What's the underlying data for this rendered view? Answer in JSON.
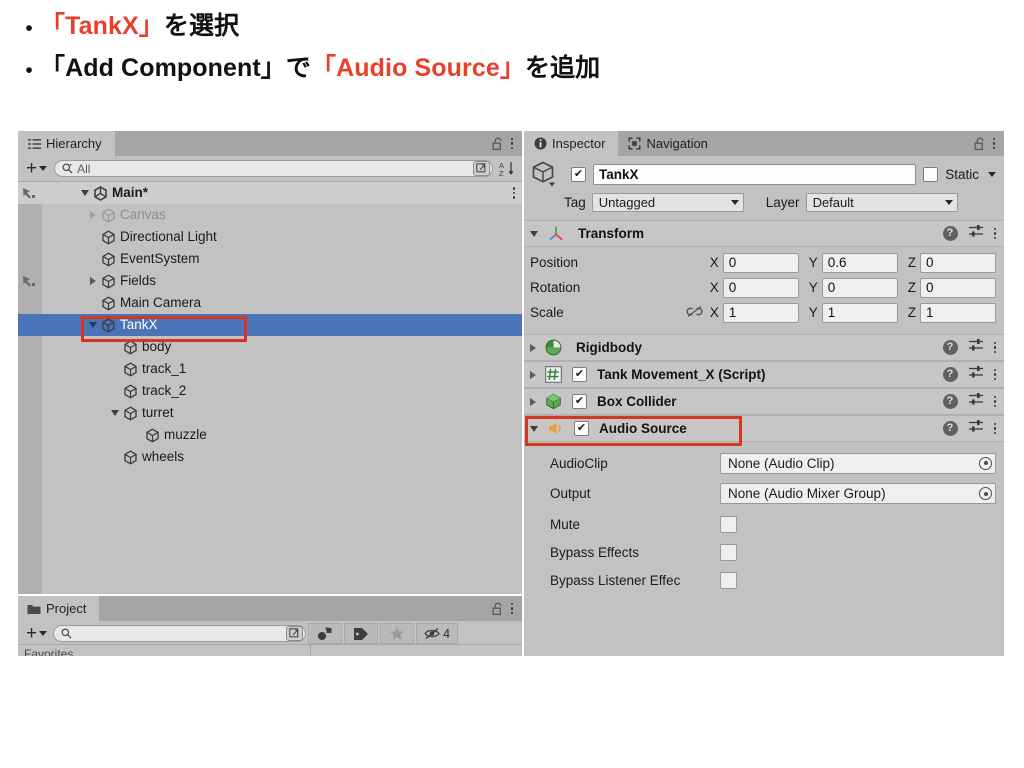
{
  "slide": {
    "bullets": [
      {
        "marker": "•",
        "segments": [
          {
            "text": "「TankX」",
            "color": "red"
          },
          {
            "text": "を選択",
            "color": "black"
          }
        ]
      },
      {
        "marker": "•",
        "segments": [
          {
            "text": "「Add Component」",
            "color": "black"
          },
          {
            "text": "で",
            "color": "black"
          },
          {
            "text": "「Audio Source」",
            "color": "red"
          },
          {
            "text": "を追加",
            "color": "black"
          }
        ]
      }
    ],
    "accent_color": "#e8402a",
    "text_color": "#111111"
  },
  "hierarchy": {
    "tab_label": "Hierarchy",
    "tab_icon": "hierarchy-list-icon",
    "lock_icon": "lock-open-icon",
    "menu_icon": "kebab-menu-icon",
    "toolbar": {
      "create_label": "+",
      "create_dropdown_icon": "chevron-down-icon",
      "search_placeholder": "All",
      "search_value": "",
      "search_icon": "search-icon",
      "search_save_icon": "save-search-icon",
      "sort_icon": "alphabetical-sort-icon",
      "sort_label": "A\nZ"
    },
    "scene": {
      "label": "Main*",
      "icon": "unity-scene-icon",
      "expanded": true,
      "kebab": "kebab-menu-icon"
    },
    "items": [
      {
        "label": "Canvas",
        "depth": 1,
        "expandable": true,
        "expanded": false,
        "dimmed": true,
        "selected": false,
        "gutter_icon": ""
      },
      {
        "label": "Directional Light",
        "depth": 1,
        "expandable": false,
        "expanded": false,
        "dimmed": false,
        "selected": false,
        "gutter_icon": ""
      },
      {
        "label": "EventSystem",
        "depth": 1,
        "expandable": false,
        "expanded": false,
        "dimmed": false,
        "selected": false,
        "gutter_icon": ""
      },
      {
        "label": "Fields",
        "depth": 1,
        "expandable": true,
        "expanded": false,
        "dimmed": false,
        "selected": false,
        "gutter_icon": "prefab-icon"
      },
      {
        "label": "Main Camera",
        "depth": 1,
        "expandable": false,
        "expanded": false,
        "dimmed": false,
        "selected": false,
        "gutter_icon": ""
      },
      {
        "label": "TankX",
        "depth": 1,
        "expandable": true,
        "expanded": true,
        "dimmed": false,
        "selected": true,
        "gutter_icon": ""
      },
      {
        "label": "body",
        "depth": 2,
        "expandable": false,
        "expanded": false,
        "dimmed": false,
        "selected": false,
        "gutter_icon": ""
      },
      {
        "label": "track_1",
        "depth": 2,
        "expandable": false,
        "expanded": false,
        "dimmed": false,
        "selected": false,
        "gutter_icon": ""
      },
      {
        "label": "track_2",
        "depth": 2,
        "expandable": false,
        "expanded": false,
        "dimmed": false,
        "selected": false,
        "gutter_icon": ""
      },
      {
        "label": "turret",
        "depth": 2,
        "expandable": true,
        "expanded": true,
        "dimmed": false,
        "selected": false,
        "gutter_icon": ""
      },
      {
        "label": "muzzle",
        "depth": 3,
        "expandable": false,
        "expanded": false,
        "dimmed": false,
        "selected": false,
        "gutter_icon": ""
      },
      {
        "label": "wheels",
        "depth": 2,
        "expandable": false,
        "expanded": false,
        "dimmed": false,
        "selected": false,
        "gutter_icon": ""
      }
    ],
    "selection_color": "#4a74b8",
    "highlight_box_color": "#d6361f"
  },
  "project": {
    "tab_label": "Project",
    "tab_icon": "folder-icon",
    "lock_icon": "lock-open-icon",
    "menu_icon": "kebab-menu-icon",
    "toolbar": {
      "create_label": "+",
      "create_dropdown_icon": "chevron-down-icon",
      "search_placeholder": "",
      "search_value": "",
      "search_icon": "search-icon",
      "search_save_icon": "save-search-icon",
      "filter_type_icon": "filter-by-type-icon",
      "filter_label_icon": "filter-by-label-icon",
      "favorites_icon": "star-icon",
      "hidden_icon": "eye-hidden-icon",
      "hidden_count": "4"
    },
    "sidebar_hint": "Favorites"
  },
  "inspector": {
    "tabs": [
      {
        "label": "Inspector",
        "icon": "info-icon",
        "active": true
      },
      {
        "label": "Navigation",
        "icon": "navigation-icon",
        "active": false
      }
    ],
    "lock_icon": "lock-open-icon",
    "menu_icon": "kebab-menu-icon",
    "object": {
      "icon": "gameobject-cube-icon",
      "enabled": true,
      "name": "TankX",
      "static_label": "Static",
      "static_checked": false,
      "static_dropdown_icon": "chevron-down-icon",
      "tag_label": "Tag",
      "tag_value": "Untagged",
      "layer_label": "Layer",
      "layer_value": "Default"
    },
    "components": [
      {
        "name": "Transform",
        "icon": "transform-axis-icon",
        "expanded": true,
        "has_toggle": false,
        "enabled": true,
        "highlighted": false,
        "help_icon": "help-icon",
        "preset_icon": "preset-sliders-icon",
        "menu_icon": "kebab-menu-icon",
        "rows": [
          {
            "label": "Position",
            "link_icon": "",
            "x": "0",
            "y": "0.6",
            "z": "0"
          },
          {
            "label": "Rotation",
            "link_icon": "",
            "x": "0",
            "y": "0",
            "z": "0"
          },
          {
            "label": "Scale",
            "link_icon": "broken-link-icon",
            "x": "1",
            "y": "1",
            "z": "1"
          }
        ],
        "axis_labels": {
          "x": "X",
          "y": "Y",
          "z": "Z"
        }
      },
      {
        "name": "Rigidbody",
        "icon": "rigidbody-icon",
        "expanded": false,
        "has_toggle": false,
        "enabled": true,
        "highlighted": false,
        "help_icon": "help-icon",
        "preset_icon": "preset-sliders-icon",
        "menu_icon": "kebab-menu-icon"
      },
      {
        "name": "Tank Movement_X (Script)",
        "icon": "script-hash-icon",
        "expanded": false,
        "has_toggle": true,
        "enabled": true,
        "highlighted": false,
        "help_icon": "help-icon",
        "preset_icon": "preset-sliders-icon",
        "menu_icon": "kebab-menu-icon"
      },
      {
        "name": "Box Collider",
        "icon": "box-collider-icon",
        "expanded": false,
        "has_toggle": true,
        "enabled": true,
        "highlighted": false,
        "help_icon": "help-icon",
        "preset_icon": "preset-sliders-icon",
        "menu_icon": "kebab-menu-icon"
      },
      {
        "name": "Audio Source",
        "icon": "audio-speaker-icon",
        "expanded": true,
        "has_toggle": true,
        "enabled": true,
        "highlighted": true,
        "help_icon": "help-icon",
        "preset_icon": "preset-sliders-icon",
        "menu_icon": "kebab-menu-icon"
      }
    ],
    "audio_source_props": [
      {
        "label": "AudioClip",
        "type": "object",
        "value": "None (Audio Clip)",
        "picker_icon": "object-picker-icon"
      },
      {
        "label": "Output",
        "type": "object",
        "value": "None (Audio Mixer Group)",
        "picker_icon": "object-picker-icon"
      },
      {
        "label": "Mute",
        "type": "bool",
        "checked": false
      },
      {
        "label": "Bypass Effects",
        "type": "bool",
        "checked": false
      },
      {
        "label": "Bypass Listener Effec",
        "type": "bool",
        "checked": false
      }
    ],
    "highlight_box_color": "#d6361f"
  }
}
